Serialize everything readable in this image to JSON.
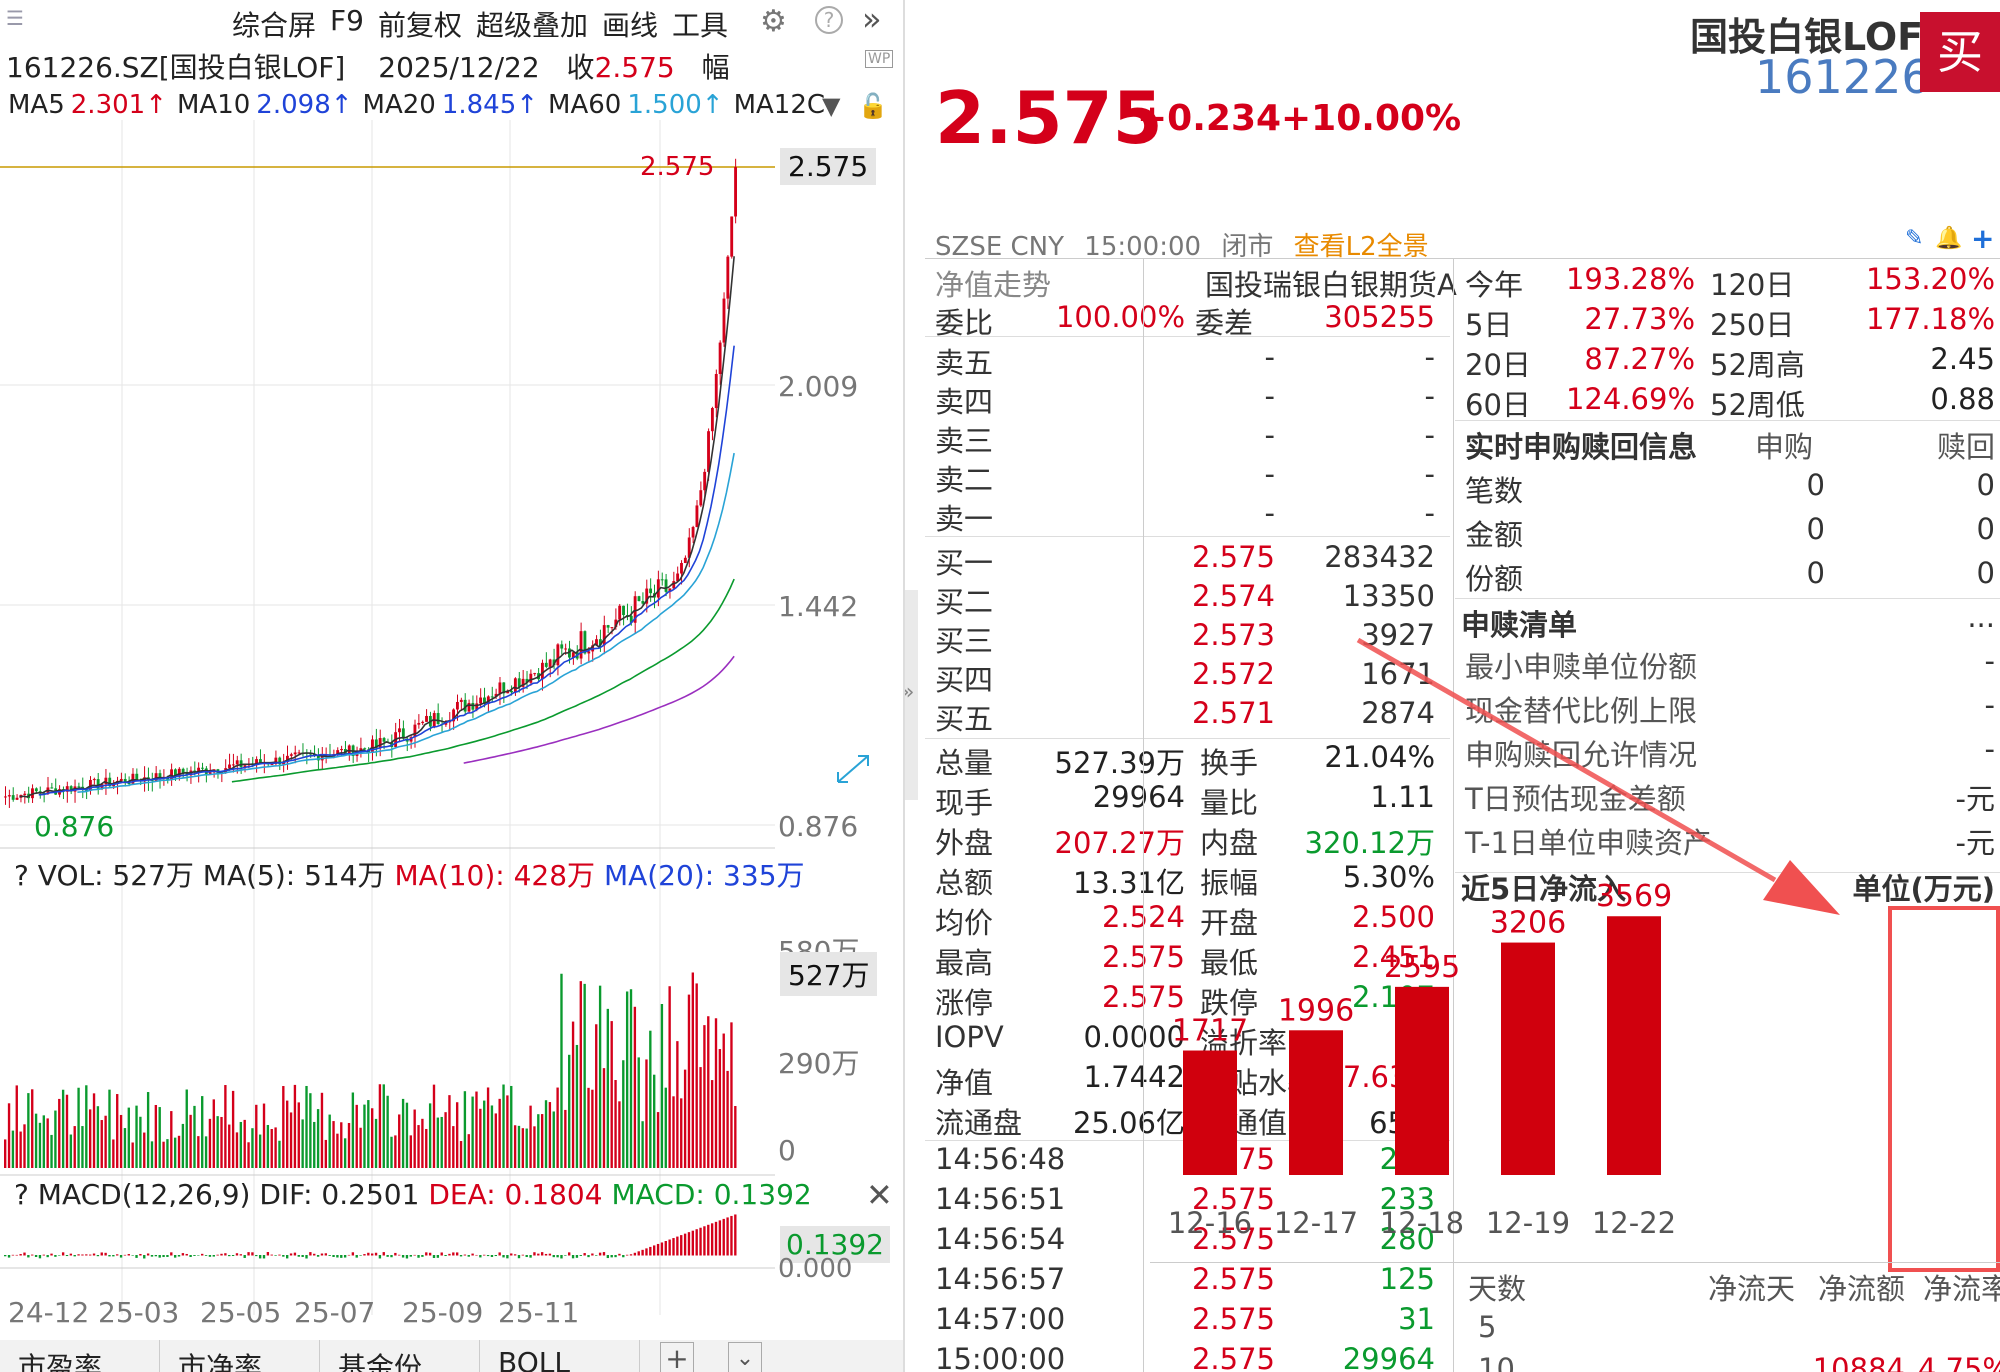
{
  "left": {
    "toolbar": [
      "综合屏",
      "F9",
      "前复权",
      "超级叠加",
      "画线",
      "工具"
    ],
    "info": {
      "code": "161226.SZ[国投白银LOF]",
      "date": "2025/12/22",
      "close_label": "收",
      "close_value": "2.575",
      "range_label": "幅"
    },
    "ma": [
      {
        "name": "MA5",
        "value": "2.301↑",
        "color": "#d4001a"
      },
      {
        "name": "MA10",
        "value": "2.098↑",
        "color": "#1f43d8"
      },
      {
        "name": "MA20",
        "value": "1.845↑",
        "color": "#1f43d8"
      },
      {
        "name": "MA60",
        "value": "1.500↑",
        "color": "#29a3d6"
      },
      {
        "name": "MA12C",
        "value": "",
        "color": "#222"
      }
    ],
    "price_axis": [
      "2.575",
      "2.009",
      "1.442",
      "0.876"
    ],
    "hi_label": "2.575",
    "lo_label": "0.876",
    "price_tag": "2.575",
    "vol_header": {
      "q": "?",
      "vol": "VOL: 527万",
      "ma5": "MA(5): 514万",
      "ma10": "MA(10): 428万",
      "ma20": "MA(20): 335万"
    },
    "vol_axis": [
      "580万",
      "290万",
      "0"
    ],
    "vol_tag": "527万",
    "macd_header": {
      "q": "?",
      "name": "MACD(12,26,9)",
      "dif": "DIF: 0.2501",
      "dea": "DEA: 0.1804",
      "macd": "MACD: 0.1392"
    },
    "macd_tag": "0.1392",
    "macd_axis": "0.000",
    "dates": [
      "24-12",
      "25-03",
      "25-05",
      "25-07",
      "25-09",
      "25-11"
    ],
    "tabs": [
      "市盈率",
      "市净率",
      "基金份...",
      "BOLL"
    ]
  },
  "chart_data": {
    "type": "line",
    "title": "",
    "series": [
      {
        "name": "",
        "values": [
          0.876,
          0.91,
          0.95,
          1.0,
          1.05,
          1.12,
          1.22,
          1.3,
          1.4,
          1.442,
          1.55,
          1.75,
          2.009,
          2.3,
          2.575
        ]
      }
    ],
    "ylim": [
      0.876,
      2.575
    ]
  },
  "header": {
    "name": "国投白银LOF",
    "code": "161226",
    "buy": "买",
    "price": "2.575",
    "change": "+0.234",
    "pct": "+10.00%",
    "exchange": "SZSE",
    "currency": "CNY",
    "time": "15:00:00",
    "status": "闭市",
    "l2": "查看L2全景"
  },
  "quote": {
    "nav_trend": "净值走势",
    "underlying": "国投瑞银白银期货A",
    "weibi_label": "委比",
    "weibi": "100.00%",
    "weicha_label": "委差",
    "weicha": "305255",
    "asks": [
      {
        "label": "卖五",
        "price": "-",
        "vol": "-"
      },
      {
        "label": "卖四",
        "price": "-",
        "vol": "-"
      },
      {
        "label": "卖三",
        "price": "-",
        "vol": "-"
      },
      {
        "label": "卖二",
        "price": "-",
        "vol": "-"
      },
      {
        "label": "卖一",
        "price": "-",
        "vol": "-"
      }
    ],
    "bids": [
      {
        "label": "买一",
        "price": "2.575",
        "vol": "283432"
      },
      {
        "label": "买二",
        "price": "2.574",
        "vol": "13350"
      },
      {
        "label": "买三",
        "price": "2.573",
        "vol": "3927"
      },
      {
        "label": "买四",
        "price": "2.572",
        "vol": "1671"
      },
      {
        "label": "买五",
        "price": "2.571",
        "vol": "2874"
      }
    ],
    "stats": [
      {
        "l1": "总量",
        "v1": "527.39万",
        "c1": "#222",
        "l2": "换手",
        "v2": "21.04%",
        "c2": "#222"
      },
      {
        "l1": "现手",
        "v1": "29964",
        "c1": "#222",
        "l2": "量比",
        "v2": "1.11",
        "c2": "#222"
      },
      {
        "l1": "外盘",
        "v1": "207.27万",
        "c1": "#d4001a",
        "l2": "内盘",
        "v2": "320.12万",
        "c2": "#0a9a2e"
      },
      {
        "l1": "总额",
        "v1": "13.31亿",
        "c1": "#222",
        "l2": "振幅",
        "v2": "5.30%",
        "c2": "#222"
      },
      {
        "l1": "均价",
        "v1": "2.524",
        "c1": "#d4001a",
        "l2": "开盘",
        "v2": "2.500",
        "c2": "#d4001a"
      },
      {
        "l1": "最高",
        "v1": "2.575",
        "c1": "#d4001a",
        "l2": "最低",
        "v2": "2.451",
        "c2": "#d4001a"
      },
      {
        "l1": "涨停",
        "v1": "2.575",
        "c1": "#d4001a",
        "l2": "跌停",
        "v2": "2.107",
        "c2": "#0a9a2e"
      },
      {
        "l1": "IOPV",
        "v1": "0.0000",
        "c1": "#222",
        "l2": "溢折率",
        "v2": "-",
        "c2": "#222"
      },
      {
        "l1": "净值",
        "v1": "1.7442",
        "c1": "#222",
        "l2": "升贴水率",
        "v2": "47.63%",
        "c2": "#d4001a"
      },
      {
        "l1": "流通盘",
        "v1": "25.06亿",
        "c1": "#222",
        "l2": "流通值",
        "v2": "65亿",
        "c2": "#222"
      }
    ],
    "ticks": [
      {
        "t": "14:56:48",
        "p": "2.575",
        "v": "283"
      },
      {
        "t": "14:56:51",
        "p": "2.575",
        "v": "233"
      },
      {
        "t": "14:56:54",
        "p": "2.575",
        "v": "280"
      },
      {
        "t": "14:56:57",
        "p": "2.575",
        "v": "125"
      },
      {
        "t": "14:57:00",
        "p": "2.575",
        "v": "31"
      },
      {
        "t": "15:00:00",
        "p": "2.575",
        "v": "29964"
      }
    ]
  },
  "perf": [
    {
      "l1": "今年",
      "v1": "193.28%",
      "l2": "120日",
      "v2": "153.20%",
      "c2": "#d4001a"
    },
    {
      "l1": "5日",
      "v1": "27.73%",
      "l2": "250日",
      "v2": "177.18%",
      "c2": "#d4001a"
    },
    {
      "l1": "20日",
      "v1": "87.27%",
      "l2": "52周高",
      "v2": "2.45",
      "c2": "#222"
    },
    {
      "l1": "60日",
      "v1": "124.69%",
      "l2": "52周低",
      "v2": "0.88",
      "c2": "#222"
    }
  ],
  "subredeem": {
    "title": "实时申购赎回信息",
    "col1": "申购",
    "col2": "赎回",
    "rows": [
      {
        "l": "笔数",
        "a": "0",
        "b": "0"
      },
      {
        "l": "金额",
        "a": "0",
        "b": "0"
      },
      {
        "l": "份额",
        "a": "0",
        "b": "0"
      }
    ]
  },
  "list": {
    "title": "申赎清单",
    "more": "...",
    "rows": [
      {
        "l": "最小申赎单位份额",
        "v": "-"
      },
      {
        "l": "现金替代比例上限",
        "v": "-"
      },
      {
        "l": "申购赎回允许情况",
        "v": "-"
      },
      {
        "l": "T日预估现金差额",
        "v": "-元"
      },
      {
        "l": "T-1日单位申赎资产",
        "v": "-元"
      }
    ]
  },
  "netflow": {
    "title": "近5日净流入",
    "unit": "单位(万元)",
    "dates": [
      "12-16",
      "12-17",
      "12-18",
      "12-19",
      "12-22"
    ],
    "values": [
      1717,
      1996,
      2595,
      3206,
      3569
    ]
  },
  "bottom_table": {
    "headers": [
      "天数",
      "净流天",
      "净流额",
      "净流率"
    ],
    "row": [
      "5",
      "",
      "",
      ""
    ],
    "row2": [
      "10",
      "",
      "10884",
      "4.75%"
    ]
  }
}
